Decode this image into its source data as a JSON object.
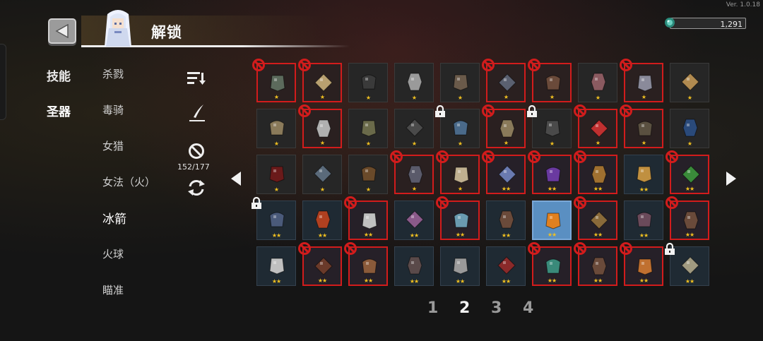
{
  "header": {
    "title": "解锁",
    "version": "Ver. 1.0.18",
    "currency_value": "1,291"
  },
  "categories": [
    {
      "label": "技能",
      "active": false
    },
    {
      "label": "圣器",
      "active": true
    }
  ],
  "characters": [
    {
      "label": "杀戮"
    },
    {
      "label": "毒骑"
    },
    {
      "label": "女猎"
    },
    {
      "label": "女法（火）"
    },
    {
      "label": "冰箭"
    },
    {
      "label": "火球"
    },
    {
      "label": "瞄准"
    }
  ],
  "tools": {
    "count_text": "152/177",
    "icons": [
      "sort-icon",
      "quill-icon",
      "ban-filter-icon",
      "refresh-icon"
    ]
  },
  "grid": {
    "rows": [
      [
        {
          "icon": "helmet",
          "stars": "★",
          "ban": true,
          "lock": false,
          "tier": 1,
          "color": "#5c6a5c"
        },
        {
          "icon": "claw",
          "stars": "★",
          "ban": true,
          "lock": false,
          "tier": 1,
          "color": "#b8a070"
        },
        {
          "icon": "necklace",
          "stars": "★",
          "ban": false,
          "lock": false,
          "tier": 1,
          "color": "#3a3a3a"
        },
        {
          "icon": "pearl",
          "stars": "★",
          "ban": false,
          "lock": false,
          "tier": 1,
          "color": "#9a9a9a"
        },
        {
          "icon": "stone",
          "stars": "★",
          "ban": false,
          "lock": false,
          "tier": 1,
          "color": "#6a5a4a"
        },
        {
          "icon": "feather-dark",
          "stars": "★",
          "ban": true,
          "lock": false,
          "tier": 1,
          "color": "#5a6070"
        },
        {
          "icon": "boots",
          "stars": "★",
          "ban": true,
          "lock": false,
          "tier": 1,
          "color": "#6a4a3a"
        },
        {
          "icon": "meat",
          "stars": "★",
          "ban": false,
          "lock": false,
          "tier": 1,
          "color": "#8a5a60"
        },
        {
          "icon": "spikes",
          "stars": "★",
          "ban": true,
          "lock": false,
          "tier": 1,
          "color": "#8a8a9a"
        },
        {
          "icon": "glove",
          "stars": "★",
          "ban": false,
          "lock": false,
          "tier": 1,
          "color": "#b08a50"
        }
      ],
      [
        {
          "icon": "quill",
          "stars": "★",
          "ban": false,
          "lock": false,
          "tier": 1,
          "color": "#8a7a5a"
        },
        {
          "icon": "fur",
          "stars": "★",
          "ban": true,
          "lock": false,
          "tier": 1,
          "color": "#b0b0b0"
        },
        {
          "icon": "bag",
          "stars": "★",
          "ban": false,
          "lock": false,
          "tier": 1,
          "color": "#6a6a4a"
        },
        {
          "icon": "pan",
          "stars": "★",
          "ban": false,
          "lock": false,
          "tier": 1,
          "color": "#4a4a4a"
        },
        {
          "icon": "band",
          "stars": "★",
          "ban": false,
          "lock": true,
          "tier": 1,
          "color": "#4a6a8a"
        },
        {
          "icon": "scroll",
          "stars": "★",
          "ban": true,
          "lock": false,
          "tier": 1,
          "color": "#8a7a5a"
        },
        {
          "icon": "flask",
          "stars": "★",
          "ban": false,
          "lock": true,
          "tier": 1,
          "color": "#4a4a4a"
        },
        {
          "icon": "magnet",
          "stars": "★",
          "ban": true,
          "lock": false,
          "tier": 1,
          "color": "#c03030"
        },
        {
          "icon": "rod",
          "stars": "★",
          "ban": true,
          "lock": false,
          "tier": 1,
          "color": "#5a5040"
        },
        {
          "icon": "banner",
          "stars": "★",
          "ban": false,
          "lock": false,
          "tier": 1,
          "color": "#2a4a7a"
        }
      ],
      [
        {
          "icon": "heart",
          "stars": "★",
          "ban": false,
          "lock": false,
          "tier": 1,
          "color": "#6a1a1a"
        },
        {
          "icon": "hook",
          "stars": "★",
          "ban": false,
          "lock": false,
          "tier": 1,
          "color": "#5a6a7a"
        },
        {
          "icon": "tooth",
          "stars": "★",
          "ban": false,
          "lock": false,
          "tier": 1,
          "color": "#6a4a2a"
        },
        {
          "icon": "blade",
          "stars": "★",
          "ban": true,
          "lock": false,
          "tier": 1,
          "color": "#5a5a6a"
        },
        {
          "icon": "bone",
          "stars": "★",
          "ban": true,
          "lock": false,
          "tier": 1,
          "color": "#c0b090"
        },
        {
          "icon": "crystal",
          "stars": "★★",
          "ban": true,
          "lock": false,
          "tier": 2,
          "color": "#6a7ab0"
        },
        {
          "icon": "horn",
          "stars": "★★",
          "ban": true,
          "lock": false,
          "tier": 2,
          "color": "#6a3aa0"
        },
        {
          "icon": "potion",
          "stars": "★★",
          "ban": true,
          "lock": false,
          "tier": 2,
          "color": "#a07030"
        },
        {
          "icon": "fist",
          "stars": "★★",
          "ban": false,
          "lock": false,
          "tier": 2,
          "color": "#c09040"
        },
        {
          "icon": "book-green",
          "stars": "★★",
          "ban": true,
          "lock": false,
          "tier": 2,
          "color": "#3a8a3a"
        }
      ],
      [
        {
          "icon": "armor",
          "stars": "★★",
          "ban": false,
          "lock": true,
          "tier": 2,
          "color": "#4a5a7a"
        },
        {
          "icon": "orb-red",
          "stars": "★★",
          "ban": false,
          "lock": false,
          "tier": 2,
          "color": "#b04020"
        },
        {
          "icon": "dice",
          "stars": "★★",
          "ban": true,
          "lock": false,
          "tier": 2,
          "color": "#c0c0c0"
        },
        {
          "icon": "tome",
          "stars": "★★",
          "ban": false,
          "lock": false,
          "tier": 2,
          "color": "#8a5a8a"
        },
        {
          "icon": "leaf",
          "stars": "★★",
          "ban": true,
          "lock": false,
          "tier": 2,
          "color": "#6a9ab0"
        },
        {
          "icon": "mask",
          "stars": "★★",
          "ban": false,
          "lock": false,
          "tier": 2,
          "color": "#6a4a3a"
        },
        {
          "icon": "coin",
          "stars": "★★",
          "ban": false,
          "lock": false,
          "tier": 2,
          "color": "#e08020",
          "selected": true
        },
        {
          "icon": "sword",
          "stars": "★★",
          "ban": true,
          "lock": false,
          "tier": 2,
          "color": "#8a6a3a"
        },
        {
          "icon": "horn-dark",
          "stars": "★★",
          "ban": false,
          "lock": false,
          "tier": 2,
          "color": "#6a4a5a"
        },
        {
          "icon": "root",
          "stars": "★★",
          "ban": true,
          "lock": false,
          "tier": 2,
          "color": "#6a4a3a"
        }
      ],
      [
        {
          "icon": "rune",
          "stars": "★★",
          "ban": false,
          "lock": false,
          "tier": 2,
          "color": "#c0c0c0"
        },
        {
          "icon": "bucket",
          "stars": "★★",
          "ban": true,
          "lock": false,
          "tier": 2,
          "color": "#6a3a2a"
        },
        {
          "icon": "shell",
          "stars": "★★",
          "ban": true,
          "lock": false,
          "tier": 2,
          "color": "#8a5a3a"
        },
        {
          "icon": "seed",
          "stars": "★★",
          "ban": false,
          "lock": false,
          "tier": 2,
          "color": "#5a4a4a"
        },
        {
          "icon": "skull",
          "stars": "★★",
          "ban": false,
          "lock": false,
          "tier": 2,
          "color": "#9a9a9a"
        },
        {
          "icon": "cape",
          "stars": "★★",
          "ban": false,
          "lock": false,
          "tier": 2,
          "color": "#8a2a2a"
        },
        {
          "icon": "card",
          "stars": "★★",
          "ban": true,
          "lock": false,
          "tier": 2,
          "color": "#3a8a7a"
        },
        {
          "icon": "meat2",
          "stars": "★★",
          "ban": true,
          "lock": false,
          "tier": 2,
          "color": "#6a4a3a"
        },
        {
          "icon": "carrot",
          "stars": "★★",
          "ban": true,
          "lock": false,
          "tier": 2,
          "color": "#c07030"
        },
        {
          "icon": "map",
          "stars": "★★",
          "ban": false,
          "lock": true,
          "tier": 2,
          "color": "#a09a80"
        }
      ]
    ]
  },
  "pagination": {
    "pages": [
      "1",
      "2",
      "3",
      "4"
    ],
    "current": "2"
  }
}
